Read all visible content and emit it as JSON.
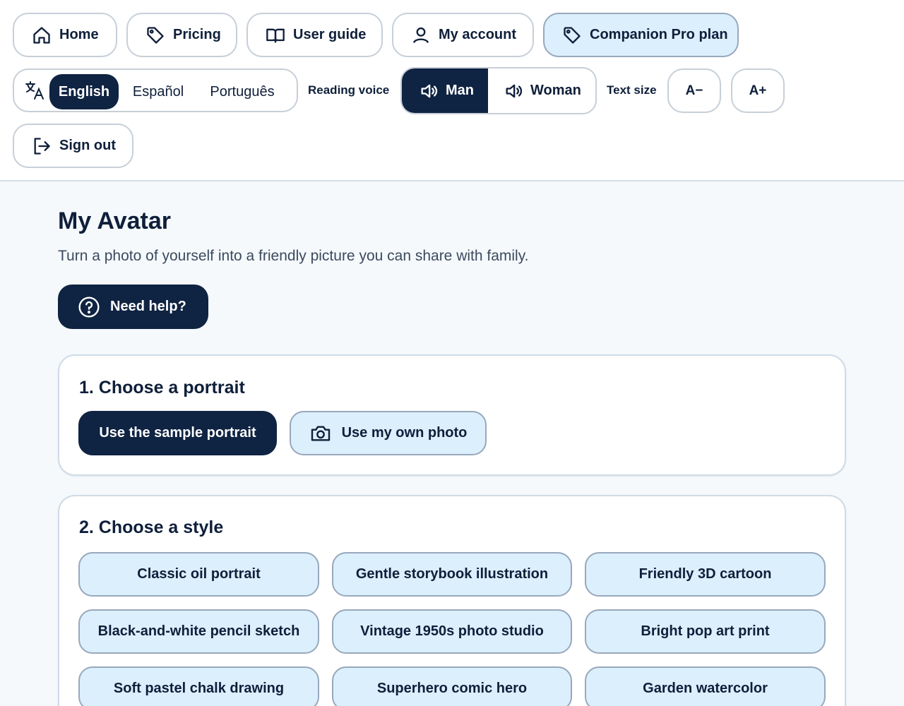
{
  "nav": {
    "home": "Home",
    "pricing": "Pricing",
    "user_guide": "User guide",
    "my_account": "My account",
    "pro_plan": "Companion Pro plan",
    "sign_out": "Sign out"
  },
  "language": {
    "options": [
      "English",
      "Español",
      "Português"
    ],
    "selected": "English"
  },
  "voice": {
    "label": "Reading voice",
    "options": [
      "Man",
      "Woman"
    ],
    "selected": "Man"
  },
  "text_size": {
    "label": "Text size",
    "decrease": "A−",
    "increase": "A+"
  },
  "page": {
    "title": "My Avatar",
    "subtitle": "Turn a photo of yourself into a friendly picture you can share with family.",
    "help": "Need help?"
  },
  "portrait": {
    "title": "1. Choose a portrait",
    "sample": "Use the sample portrait",
    "own_photo": "Use my own photo"
  },
  "style": {
    "title": "2. Choose a style",
    "options": [
      "Classic oil portrait",
      "Gentle storybook illustration",
      "Friendly 3D cartoon",
      "Black-and-white pencil sketch",
      "Vintage 1950s photo studio",
      "Bright pop art print",
      "Soft pastel chalk drawing",
      "Superhero comic hero",
      "Garden watercolor"
    ]
  },
  "colors": {
    "primary": "#0f2342",
    "accent_light": "#dbeffd",
    "background": "#f5f9fc"
  }
}
